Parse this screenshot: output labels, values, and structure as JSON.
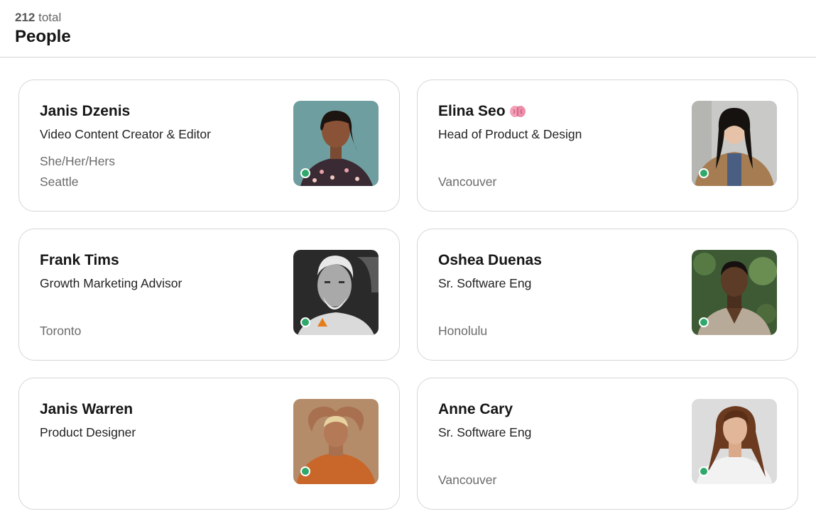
{
  "header": {
    "total_count": "212",
    "total_suffix": "total",
    "title": "People"
  },
  "people": [
    {
      "name": "Janis Dzenis",
      "role": "Video Content Creator & Editor",
      "pronouns": "She/Her/Hers",
      "location": "Seattle",
      "status": "online",
      "photo_bg": "#6f9ea0"
    },
    {
      "name": "Elina Seo",
      "badge_icon": "brain-icon",
      "role": "Head of Product & Design",
      "pronouns": "",
      "location": "Vancouver",
      "status": "online",
      "photo_bg": "#c9c9c7"
    },
    {
      "name": "Frank Tims",
      "role": "Growth Marketing Advisor",
      "pronouns": "",
      "location": "Toronto",
      "status": "online",
      "warning_icon": "warning-triangle-icon",
      "photo_bg": "#2a2a2a"
    },
    {
      "name": "Oshea Duenas",
      "role": "Sr. Software Eng",
      "pronouns": "",
      "location": "Honolulu",
      "status": "online",
      "photo_bg": "#3e5a34"
    },
    {
      "name": "Janis Warren",
      "role": "Product Designer",
      "pronouns": "",
      "location": "",
      "status": "online",
      "photo_bg": "#b48c6a"
    },
    {
      "name": "Anne Cary",
      "role": "Sr. Software Eng",
      "pronouns": "",
      "location": "Vancouver",
      "status": "online",
      "photo_bg": "#dcdcdc"
    }
  ],
  "colors": {
    "status_online": "#2fa86b",
    "warning": "#e57d1c",
    "card_border": "#d6d6d6"
  }
}
